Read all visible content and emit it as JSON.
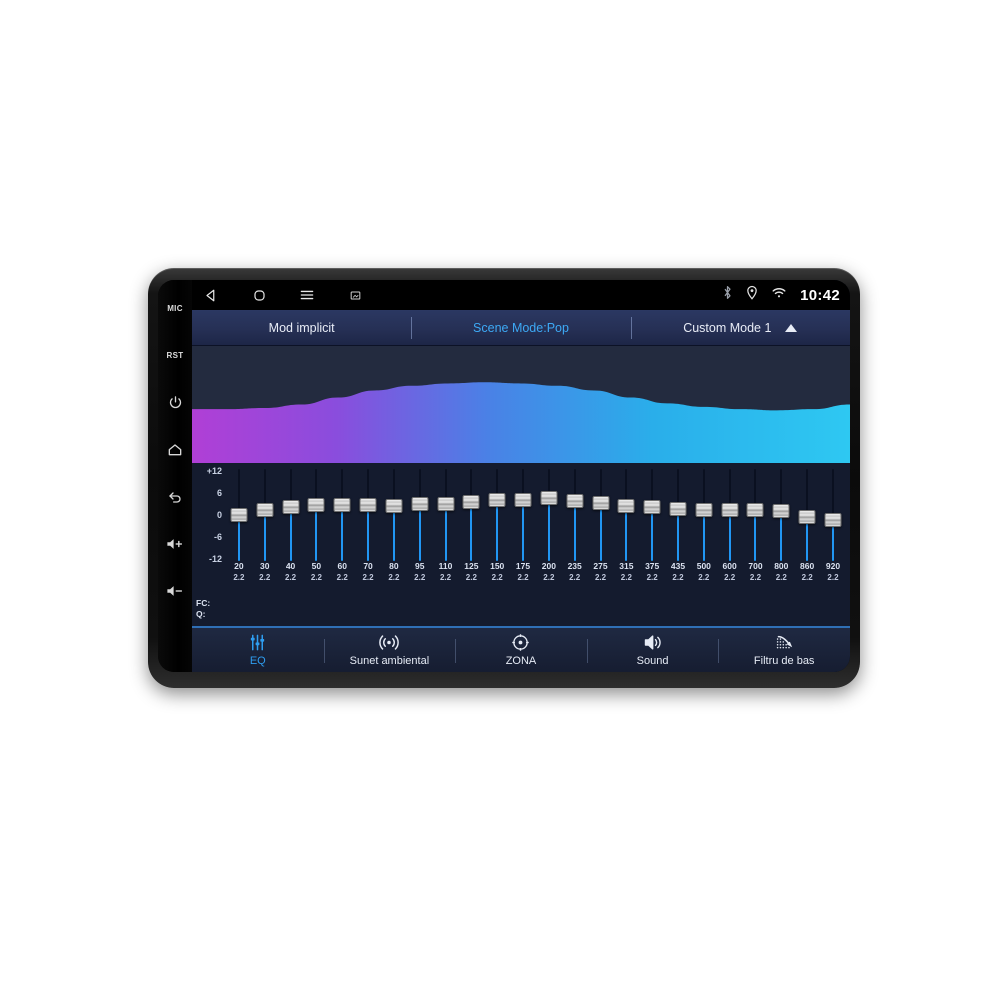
{
  "device": {
    "name": "car-head-unit"
  },
  "hardware_keys": [
    {
      "id": "mic",
      "label": "MIC",
      "type": "text"
    },
    {
      "id": "rst",
      "label": "RST",
      "type": "text"
    },
    {
      "id": "power",
      "label": "power-icon",
      "type": "icon"
    },
    {
      "id": "home",
      "label": "home-icon",
      "type": "icon"
    },
    {
      "id": "back",
      "label": "back-arrow-icon",
      "type": "icon"
    },
    {
      "id": "vol-up",
      "label": "volume-up-icon",
      "type": "icon"
    },
    {
      "id": "vol-down",
      "label": "volume-down-icon",
      "type": "icon"
    }
  ],
  "statusbar": {
    "nav": [
      {
        "id": "back",
        "icon": "back-triangle-icon"
      },
      {
        "id": "home",
        "icon": "home-square-icon"
      },
      {
        "id": "menu",
        "icon": "hamburger-menu-icon"
      },
      {
        "id": "recents",
        "icon": "screenshot-icon"
      }
    ],
    "indicators": [
      {
        "id": "bluetooth",
        "icon": "bluetooth-icon"
      },
      {
        "id": "location",
        "icon": "location-pin-icon"
      },
      {
        "id": "wifi",
        "icon": "wifi-icon"
      }
    ],
    "clock": "10:42"
  },
  "modebar": {
    "default_mode": "Mod implicit",
    "scene_mode": "Scene Mode:Pop",
    "custom_mode": "Custom Mode 1",
    "accent_color": "#3da9f5"
  },
  "equalizer": {
    "db_axis": [
      "+12",
      "6",
      "0",
      "-6",
      "-12"
    ],
    "db_range": [
      -12,
      12
    ],
    "fc_row_label": "FC:",
    "q_row_label": "Q:",
    "bands": [
      {
        "fc": "20",
        "q": "2.2",
        "gain": 0.0
      },
      {
        "fc": "30",
        "q": "2.2",
        "gain": 1.2
      },
      {
        "fc": "40",
        "q": "2.2",
        "gain": 2.0
      },
      {
        "fc": "50",
        "q": "2.2",
        "gain": 2.6
      },
      {
        "fc": "60",
        "q": "2.2",
        "gain": 2.6
      },
      {
        "fc": "70",
        "q": "2.2",
        "gain": 2.6
      },
      {
        "fc": "80",
        "q": "2.2",
        "gain": 2.4
      },
      {
        "fc": "95",
        "q": "2.2",
        "gain": 2.8
      },
      {
        "fc": "110",
        "q": "2.2",
        "gain": 3.0
      },
      {
        "fc": "125",
        "q": "2.2",
        "gain": 3.4
      },
      {
        "fc": "150",
        "q": "2.2",
        "gain": 3.8
      },
      {
        "fc": "175",
        "q": "2.2",
        "gain": 4.0
      },
      {
        "fc": "200",
        "q": "2.2",
        "gain": 4.4
      },
      {
        "fc": "235",
        "q": "2.2",
        "gain": 3.6
      },
      {
        "fc": "275",
        "q": "2.2",
        "gain": 3.2
      },
      {
        "fc": "315",
        "q": "2.2",
        "gain": 2.4
      },
      {
        "fc": "375",
        "q": "2.2",
        "gain": 2.0
      },
      {
        "fc": "435",
        "q": "2.2",
        "gain": 1.6
      },
      {
        "fc": "500",
        "q": "2.2",
        "gain": 1.4
      },
      {
        "fc": "600",
        "q": "2.2",
        "gain": 1.2
      },
      {
        "fc": "700",
        "q": "2.2",
        "gain": 1.2
      },
      {
        "fc": "800",
        "q": "2.2",
        "gain": 1.0
      },
      {
        "fc": "860",
        "q": "2.2",
        "gain": -0.4
      },
      {
        "fc": "920",
        "q": "2.2",
        "gain": -1.2
      }
    ]
  },
  "waveform": {
    "gradient": [
      "#b03fd6",
      "#7a4fe0",
      "#3f8ae8",
      "#29b6e8",
      "#2ec5f0"
    ],
    "background": "#232b3f",
    "points": [
      0.54,
      0.54,
      0.53,
      0.5,
      0.44,
      0.38,
      0.34,
      0.32,
      0.31,
      0.32,
      0.34,
      0.38,
      0.44,
      0.49,
      0.52,
      0.54,
      0.55,
      0.54,
      0.5
    ]
  },
  "tabbar": {
    "tabs": [
      {
        "id": "eq",
        "label": "EQ",
        "icon": "sliders-icon",
        "active": true
      },
      {
        "id": "ambient",
        "label": "Sunet ambiental",
        "icon": "sound-wave-icon",
        "active": false
      },
      {
        "id": "zone",
        "label": "ZONA",
        "icon": "target-icon",
        "active": false
      },
      {
        "id": "sound",
        "label": "Sound",
        "icon": "speaker-icon",
        "active": false
      },
      {
        "id": "bass",
        "label": "Filtru de bas",
        "icon": "bass-filter-icon",
        "active": false
      }
    ]
  }
}
